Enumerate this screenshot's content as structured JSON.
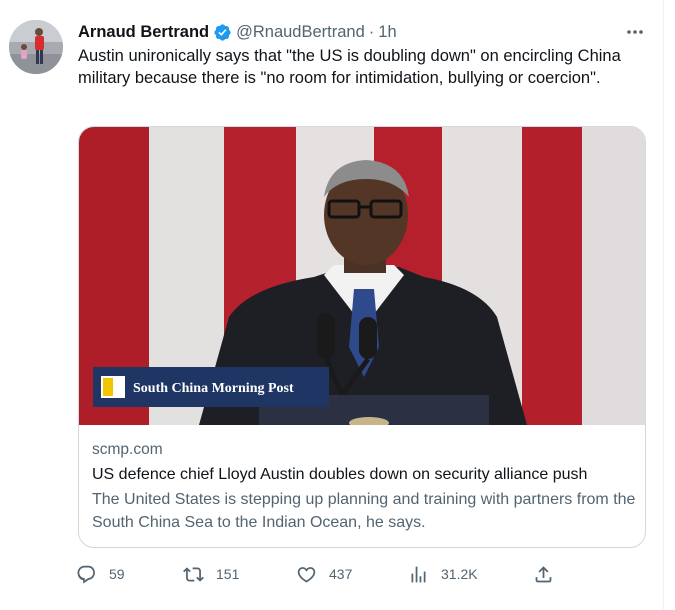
{
  "tweet": {
    "author_name": "Arnaud Bertrand",
    "handle": "@RnaudBertrand",
    "separator": "·",
    "time": "1h",
    "text": "Austin unironically says that \"the US is doubling down\" on encircling China military because there is \"no room for intimidation, bullying or coercion\"."
  },
  "card": {
    "image_logo_text": "South China Morning Post",
    "domain": "scmp.com",
    "title": "US defence chief Lloyd Austin doubles down on security alliance push",
    "description": "The United States is stepping up planning and training with partners from the South China Sea to the Indian Ocean, he says."
  },
  "actions": {
    "replies": "59",
    "reposts": "151",
    "likes": "437",
    "views": "31.2K"
  },
  "icons": {
    "verified": "verified-badge-icon",
    "more": "more-dots-icon",
    "reply": "reply-icon",
    "repost": "repost-icon",
    "like": "heart-icon",
    "views": "views-chart-icon",
    "share": "share-icon"
  },
  "colors": {
    "verified": "#1d9bf0",
    "secondary_text": "#536471",
    "primary_text": "#0f1419",
    "card_border": "#cfd9de",
    "logo_box": "#1f3564",
    "logo_accent": "#f3c400"
  }
}
